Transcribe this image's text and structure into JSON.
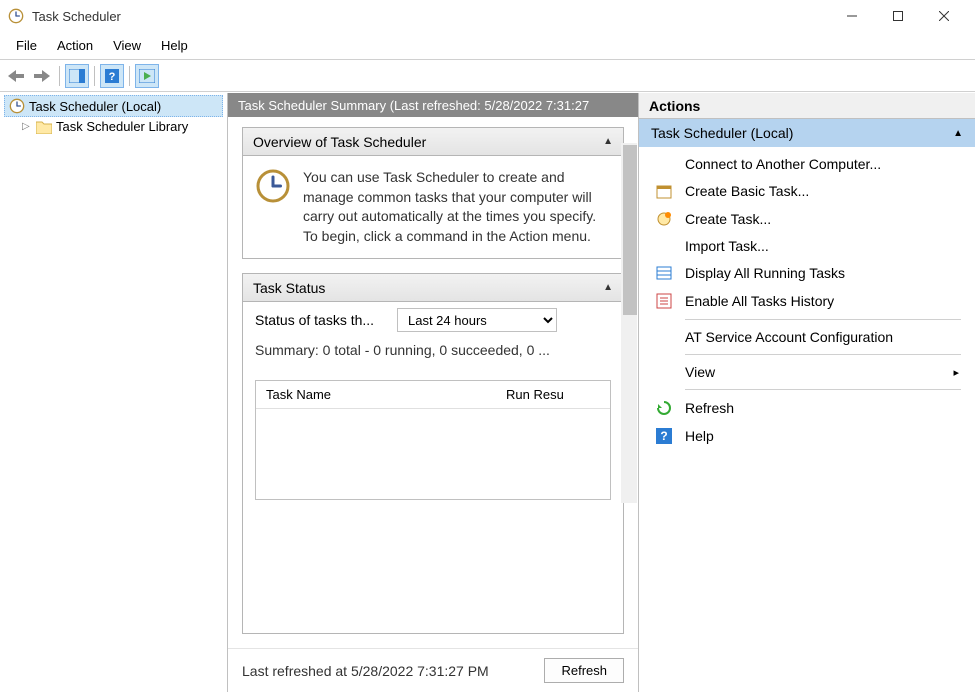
{
  "window": {
    "title": "Task Scheduler"
  },
  "menubar": [
    "File",
    "Action",
    "View",
    "Help"
  ],
  "tree": {
    "root": "Task Scheduler (Local)",
    "child": "Task Scheduler Library"
  },
  "content": {
    "header": "Task Scheduler Summary (Last refreshed: 5/28/2022 7:31:27",
    "overview": {
      "title": "Overview of Task Scheduler",
      "body": "You can use Task Scheduler to create and manage common tasks that your computer will carry out automatically at the times you specify. To begin, click a command in the Action menu."
    },
    "task_status": {
      "title": "Task Status",
      "status_label": "Status of tasks th...",
      "period_selected": "Last 24 hours",
      "summary": "Summary: 0 total - 0 running, 0 succeeded, 0 ...",
      "columns": [
        "Task Name",
        "Run Resu"
      ]
    },
    "footer": {
      "last_refreshed": "Last refreshed at 5/28/2022 7:31:27 PM",
      "refresh_btn": "Refresh"
    }
  },
  "actions": {
    "header": "Actions",
    "subheader": "Task Scheduler (Local)",
    "items": [
      {
        "label": "Connect to Another Computer...",
        "icon": "none"
      },
      {
        "label": "Create Basic Task...",
        "icon": "basic-task"
      },
      {
        "label": "Create Task...",
        "icon": "task"
      },
      {
        "label": "Import Task...",
        "icon": "none"
      },
      {
        "label": "Display All Running Tasks",
        "icon": "display"
      },
      {
        "label": "Enable All Tasks History",
        "icon": "history"
      },
      {
        "label": "AT Service Account Configuration",
        "icon": "none",
        "sep_before": true
      },
      {
        "label": "View",
        "icon": "none",
        "submenu": true,
        "sep_before": true
      },
      {
        "label": "Refresh",
        "icon": "refresh",
        "sep_before": true
      },
      {
        "label": "Help",
        "icon": "help"
      }
    ]
  }
}
